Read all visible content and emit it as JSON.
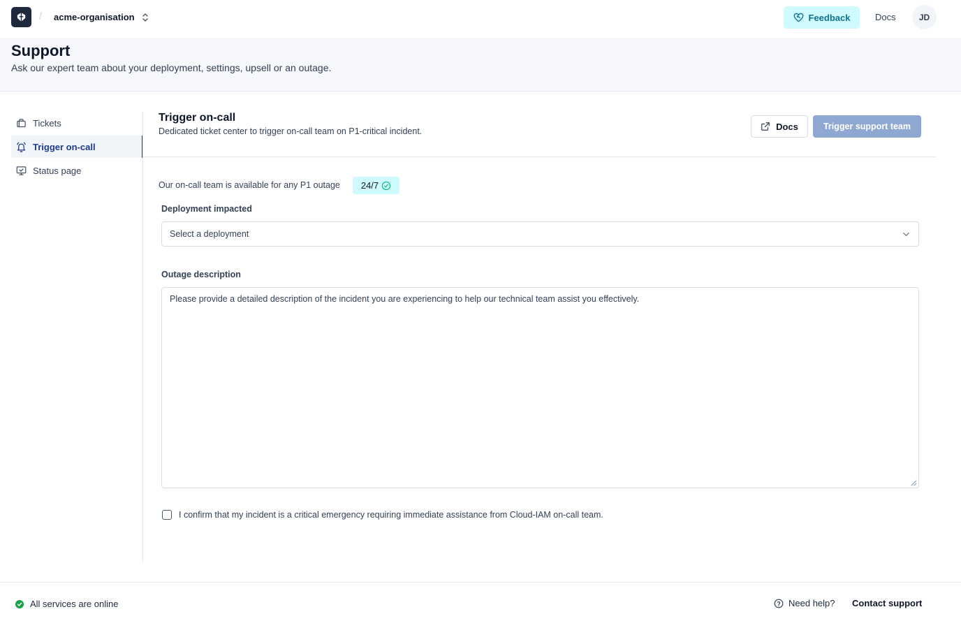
{
  "topbar": {
    "org_name": "acme-organisation",
    "separator": "/",
    "feedback_label": "Feedback",
    "docs_label": "Docs",
    "avatar_initials": "JD",
    "logo_icon": "brand-logo-icon",
    "switch_icon": "chevron-up-down-icon",
    "feedback_icon": "heart-handshake-icon"
  },
  "header": {
    "title": "Support",
    "subtitle": "Ask our expert team about your deployment, settings, upsell or an outage."
  },
  "sidebar": {
    "items": [
      {
        "label": "Tickets",
        "icon": "briefcase-icon",
        "active": false
      },
      {
        "label": "Trigger on-call",
        "icon": "bell-ring-icon",
        "active": true
      },
      {
        "label": "Status page",
        "icon": "monitor-check-icon",
        "active": false
      }
    ]
  },
  "main": {
    "title": "Trigger on-call",
    "subtitle": "Dedicated ticket center to trigger on-call team on P1-critical incident.",
    "docs_button": "Docs",
    "trigger_button": "Trigger support team",
    "availability_text": "Our on-call team is available for any P1 outage",
    "availability_badge": "24/7",
    "deployment_label": "Deployment impacted",
    "deployment_placeholder": "Select a deployment",
    "description_label": "Outage description",
    "description_placeholder": "Please provide a detailed description of the incident you are experiencing to help our technical team assist you effectively.",
    "confirm_text": "I confirm that my incident is a critical emergency requiring immediate assistance from Cloud-IAM on-call team.",
    "confirm_checked": false
  },
  "footer": {
    "status_text": "All services are online",
    "status_color": "#16a34a",
    "help_label": "Need help?",
    "contact_label": "Contact support"
  },
  "colors": {
    "accent": "#1e3a8a",
    "feedback_bg": "#cffafe",
    "trigger_button_bg": "#8ea8d1"
  }
}
